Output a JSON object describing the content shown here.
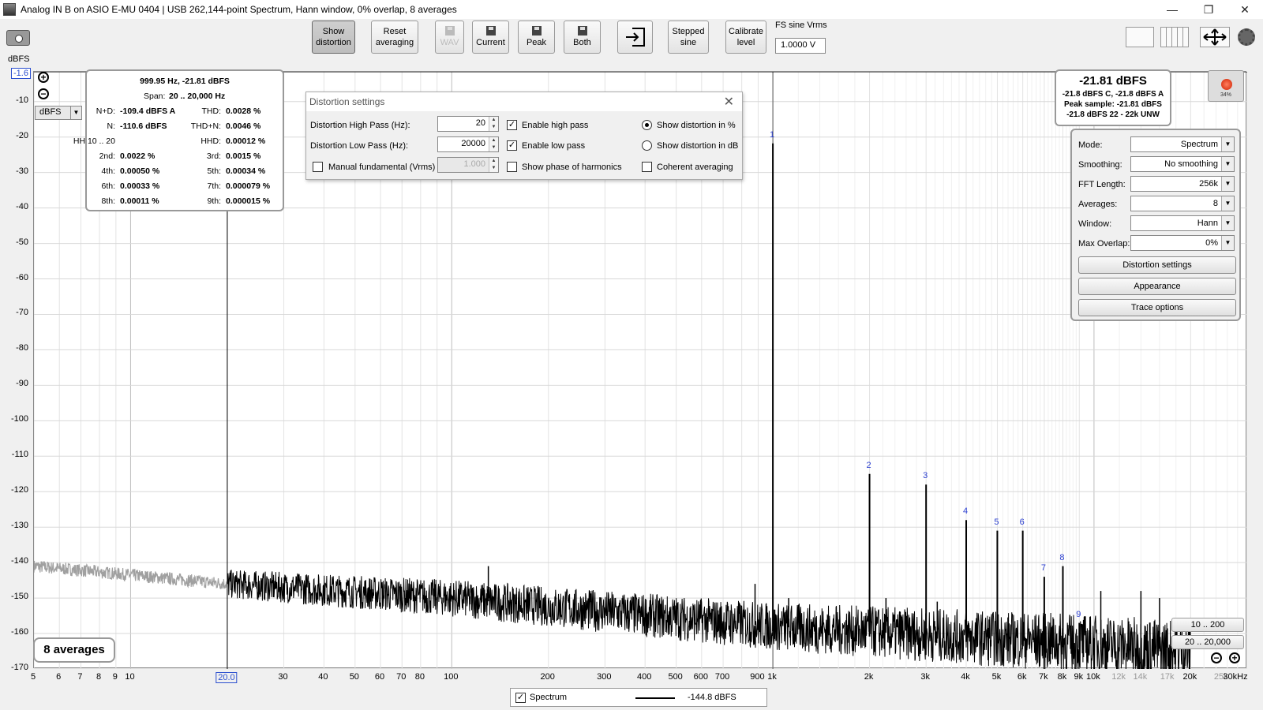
{
  "window": {
    "title": "Analog IN B on ASIO E-MU 0404 | USB 262,144-point Spectrum, Hann window, 0% overlap, 8 averages",
    "minimize": "—",
    "restore": "❐",
    "close": "✕"
  },
  "toolbar": {
    "show_distortion": [
      "Show",
      "distortion"
    ],
    "reset_averaging": [
      "Reset",
      "averaging"
    ],
    "wav": "WAV",
    "current": "Current",
    "peak": "Peak",
    "both": "Both",
    "stepped_sine": [
      "Stepped",
      "sine"
    ],
    "calibrate_level": [
      "Calibrate",
      "level"
    ],
    "fs_sine_label": "FS sine Vrms",
    "fs_sine_value": "1.0000 V"
  },
  "plot": {
    "y_units": "dBFS",
    "y_top": "-1.6",
    "y_ticks": [
      "-10",
      "-20",
      "-30",
      "-40",
      "-50",
      "-60",
      "-70",
      "-80",
      "-90",
      "-100",
      "-110",
      "-120",
      "-130",
      "-140",
      "-150",
      "-160",
      "-170"
    ],
    "x_ticks": [
      {
        "f": 5,
        "l": "5"
      },
      {
        "f": 6,
        "l": "6"
      },
      {
        "f": 7,
        "l": "7"
      },
      {
        "f": 8,
        "l": "8"
      },
      {
        "f": 9,
        "l": "9"
      },
      {
        "f": 10,
        "l": "10"
      },
      {
        "f": 20,
        "l": "20.0",
        "boxed": true
      },
      {
        "f": 30,
        "l": "30"
      },
      {
        "f": 40,
        "l": "40"
      },
      {
        "f": 50,
        "l": "50"
      },
      {
        "f": 60,
        "l": "60"
      },
      {
        "f": 70,
        "l": "70"
      },
      {
        "f": 80,
        "l": "80"
      },
      {
        "f": 100,
        "l": "100"
      },
      {
        "f": 200,
        "l": "200"
      },
      {
        "f": 300,
        "l": "300"
      },
      {
        "f": 400,
        "l": "400"
      },
      {
        "f": 500,
        "l": "500"
      },
      {
        "f": 600,
        "l": "600"
      },
      {
        "f": 700,
        "l": "700"
      },
      {
        "f": 900,
        "l": "900"
      },
      {
        "f": 1000,
        "l": "1k"
      },
      {
        "f": 2000,
        "l": "2k"
      },
      {
        "f": 3000,
        "l": "3k"
      },
      {
        "f": 4000,
        "l": "4k"
      },
      {
        "f": 5000,
        "l": "5k"
      },
      {
        "f": 6000,
        "l": "6k"
      },
      {
        "f": 7000,
        "l": "7k"
      },
      {
        "f": 8000,
        "l": "8k"
      },
      {
        "f": 9000,
        "l": "9k"
      },
      {
        "f": 10000,
        "l": "10k"
      },
      {
        "f": 12000,
        "l": "12k",
        "grey": true
      },
      {
        "f": 14000,
        "l": "14k",
        "grey": true
      },
      {
        "f": 17000,
        "l": "17k",
        "grey": true
      },
      {
        "f": 20000,
        "l": "20k"
      },
      {
        "f": 25000,
        "l": "25k",
        "grey": true
      },
      {
        "f": 30000,
        "l": "30kHz"
      }
    ],
    "unit_select": "dBFS",
    "averages_badge": "8 averages",
    "range_buttons": [
      "10 .. 200",
      "20 .. 20,000"
    ]
  },
  "chart_data": {
    "type": "line",
    "xlabel": "",
    "ylabel": "dBFS",
    "x_scale": "log",
    "xlim": [
      5,
      30000
    ],
    "ylim": [
      -170,
      -1.6
    ],
    "series": [
      {
        "name": "Spectrum",
        "noise_floor_dbfs": [
          [
            5,
            -141
          ],
          [
            20,
            -146
          ],
          [
            100,
            -150
          ],
          [
            1000,
            -158
          ],
          [
            10000,
            -163
          ],
          [
            20000,
            -165
          ]
        ]
      }
    ],
    "harmonics": [
      {
        "n": "1",
        "f": 1000,
        "db": -21.8
      },
      {
        "n": "2",
        "f": 2000,
        "db": -115
      },
      {
        "n": "3",
        "f": 3000,
        "db": -118
      },
      {
        "n": "4",
        "f": 4000,
        "db": -128
      },
      {
        "n": "5",
        "f": 5000,
        "db": -131
      },
      {
        "n": "6",
        "f": 6000,
        "db": -131
      },
      {
        "n": "7",
        "f": 7000,
        "db": -144
      },
      {
        "n": "8",
        "f": 8000,
        "db": -141
      },
      {
        "n": "9",
        "f": 9000,
        "db": -157
      }
    ],
    "spurs": [
      {
        "f": 130,
        "db": -141
      },
      {
        "f": 880,
        "db": -146
      },
      {
        "f": 1120,
        "db": -150
      },
      {
        "f": 2250,
        "db": -150
      },
      {
        "f": 3250,
        "db": -151
      },
      {
        "f": 10500,
        "db": -148
      },
      {
        "f": 14000,
        "db": -148
      },
      {
        "f": 16000,
        "db": -150
      }
    ],
    "legend_position": "bottom-center"
  },
  "distortion_readout": {
    "header": "999.95 Hz, -21.81 dBFS",
    "span_label": "Span:",
    "span_value": "20 .. 20,000 Hz",
    "rows": [
      {
        "l1": "N+D:",
        "v1": "-109.4 dBFS A",
        "l2": "THD:",
        "v2": "0.0028 %"
      },
      {
        "l1": "N:",
        "v1": "-110.6 dBFS",
        "l2": "THD+N:",
        "v2": "0.0046 %"
      },
      {
        "l1": "HH 10 .. 20",
        "v1": "",
        "l2": "HHD:",
        "v2": "0.00012 %"
      },
      {
        "l1": "2nd:",
        "v1": "0.0022 %",
        "l2": "3rd:",
        "v2": "0.0015 %"
      },
      {
        "l1": "4th:",
        "v1": "0.00050 %",
        "l2": "5th:",
        "v2": "0.00034 %"
      },
      {
        "l1": "6th:",
        "v1": "0.00033 %",
        "l2": "7th:",
        "v2": "0.000079 %"
      },
      {
        "l1": "8th:",
        "v1": "0.00011 %",
        "l2": "9th:",
        "v2": "0.000015 %"
      }
    ]
  },
  "dialog": {
    "title": "Distortion settings",
    "high_pass_label": "Distortion High Pass (Hz):",
    "high_pass_value": "20",
    "low_pass_label": "Distortion Low Pass (Hz):",
    "low_pass_value": "20000",
    "manual_fund_label": "Manual fundamental (Vrms)",
    "manual_fund_value": "1.000",
    "enable_high_pass": "Enable high pass",
    "enable_low_pass": "Enable low pass",
    "show_phase": "Show phase of harmonics",
    "show_pct": "Show distortion in %",
    "show_db": "Show distortion in dB",
    "coherent": "Coherent averaging",
    "check_mark": "✓"
  },
  "level": {
    "main": "-21.81 dBFS",
    "line1": "-21.8 dBFS C, -21.8 dBFS A",
    "line2": "Peak sample: -21.81 dBFS",
    "line3": "-21.8 dBFS 22 - 22k UNW",
    "record_pct": "34%"
  },
  "controls": {
    "mode_label": "Mode:",
    "mode_value": "Spectrum",
    "smoothing_label": "Smoothing:",
    "smoothing_value": "No smoothing",
    "fft_label": "FFT Length:",
    "fft_value": "256k",
    "avg_label": "Averages:",
    "avg_value": "8",
    "window_label": "Window:",
    "window_value": "Hann",
    "overlap_label": "Max Overlap:",
    "overlap_value": "0%",
    "dist_btn": "Distortion settings",
    "appearance_btn": "Appearance",
    "trace_btn": "Trace options"
  },
  "legend": {
    "name": "Spectrum",
    "value": "-144.8 dBFS"
  }
}
